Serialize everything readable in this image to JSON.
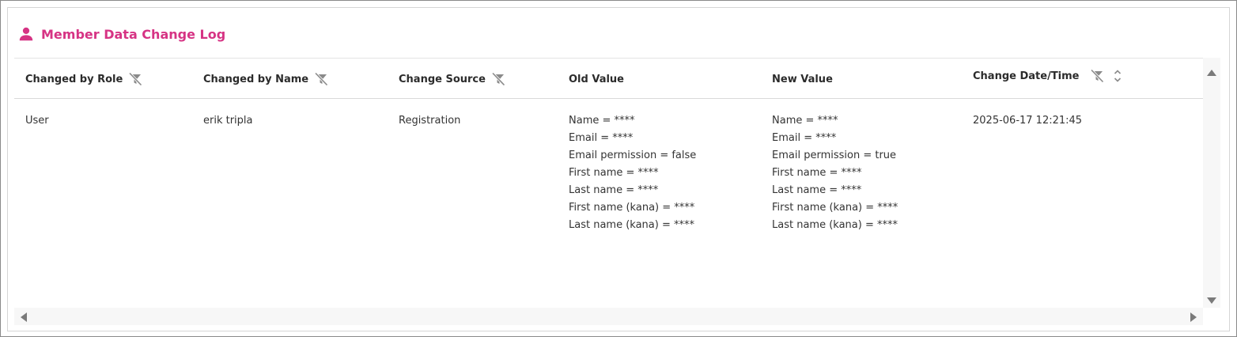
{
  "panel": {
    "title": "Member Data Change Log",
    "title_color": "#d63384"
  },
  "table": {
    "headers": [
      {
        "label": "Changed by Role",
        "filter": true,
        "sort": false
      },
      {
        "label": "Changed by Name",
        "filter": true,
        "sort": false
      },
      {
        "label": "Change Source",
        "filter": true,
        "sort": false
      },
      {
        "label": "Old Value",
        "filter": false,
        "sort": false
      },
      {
        "label": "New Value",
        "filter": false,
        "sort": false
      },
      {
        "label": "Change Date/Time",
        "filter": true,
        "sort": true
      }
    ],
    "rows": [
      {
        "role": "User",
        "name": "erik tripla",
        "source": "Registration",
        "old_value": [
          "Name = ****",
          "Email = ****",
          "Email permission = false",
          "First name = ****",
          "Last name = ****",
          "First name (kana) = ****",
          "Last name (kana) = ****"
        ],
        "new_value": [
          "Name = ****",
          "Email = ****",
          "Email permission = true",
          "First name = ****",
          "Last name = ****",
          "First name (kana) = ****",
          "Last name (kana) = ****"
        ],
        "datetime": "2025-06-17 12:21:45"
      }
    ]
  },
  "icons": {
    "title": "user-icon",
    "filter": "filter-off-icon",
    "sort": "sort-icon",
    "scroll_up": "arrow-up-icon",
    "scroll_down": "arrow-down-icon",
    "scroll_left": "arrow-left-icon",
    "scroll_right": "arrow-right-icon"
  }
}
